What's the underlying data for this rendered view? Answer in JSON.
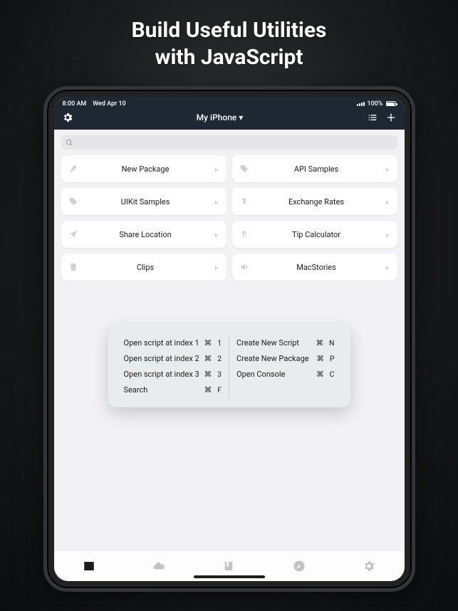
{
  "headline_line1": "Build Useful Utilities",
  "headline_line2": "with JavaScript",
  "status": {
    "time": "8:00 AM",
    "date": "Wed Apr 10",
    "battery": "100%"
  },
  "header": {
    "title": "My iPhone ▾"
  },
  "cards": [
    {
      "label": "New Package",
      "icon": "rocket"
    },
    {
      "label": "API Samples",
      "icon": "tag"
    },
    {
      "label": "UIKit Samples",
      "icon": "tag"
    },
    {
      "label": "Exchange Rates",
      "icon": "dollar"
    },
    {
      "label": "Share Location",
      "icon": "location"
    },
    {
      "label": "Tip Calculator",
      "icon": "fork"
    },
    {
      "label": "Clips",
      "icon": "doc"
    },
    {
      "label": "MacStories",
      "icon": "speaker"
    }
  ],
  "shortcuts": {
    "cmd_symbol": "⌘",
    "left": [
      {
        "label": "Open script at index 1",
        "key": "1"
      },
      {
        "label": "Open script at index 2",
        "key": "2"
      },
      {
        "label": "Open script at index 3",
        "key": "3"
      },
      {
        "label": "Search",
        "key": "F"
      }
    ],
    "right": [
      {
        "label": "Create New Script",
        "key": "N"
      },
      {
        "label": "Create New Package",
        "key": "P"
      },
      {
        "label": "Open Console",
        "key": "C"
      }
    ]
  },
  "tabs": [
    "console",
    "cloud",
    "bookmark",
    "compass",
    "gear"
  ]
}
